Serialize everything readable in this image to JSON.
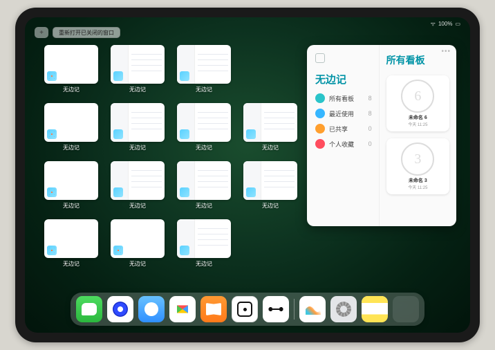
{
  "status": {
    "battery": "100%",
    "wifi": "􀙇"
  },
  "topbar": {
    "new_tab": "+",
    "reopen_label": "重新打开已关闭的窗口"
  },
  "grid": {
    "app_label": "无边记",
    "tiles": [
      {
        "variant": "blank"
      },
      {
        "variant": "list"
      },
      {
        "variant": "list"
      },
      {
        "variant": "blank"
      },
      {
        "variant": "list"
      },
      {
        "variant": "list"
      },
      {
        "variant": "list"
      },
      {
        "variant": "blank"
      },
      {
        "variant": "list"
      },
      {
        "variant": "list"
      },
      {
        "variant": "list"
      },
      {
        "variant": "blank"
      },
      {
        "variant": "blank"
      },
      {
        "variant": "list"
      }
    ]
  },
  "panel": {
    "left_title": "无边记",
    "right_title": "所有看板",
    "items": [
      {
        "icon_color": "#2ac4c9",
        "label": "所有看板",
        "count": "8"
      },
      {
        "icon_color": "#36b6ff",
        "label": "最近使用",
        "count": "8"
      },
      {
        "icon_color": "#ff9f2e",
        "label": "已共享",
        "count": "0"
      },
      {
        "icon_color": "#ff4d5e",
        "label": "个人收藏",
        "count": "0"
      }
    ],
    "cards": [
      {
        "name": "未命名 6",
        "time": "今天 11:25",
        "sketch": "six"
      },
      {
        "name": "未命名 3",
        "time": "今天 11:25",
        "sketch": "three"
      }
    ]
  },
  "dock": [
    {
      "name": "wechat"
    },
    {
      "name": "browser1"
    },
    {
      "name": "browser2"
    },
    {
      "name": "play"
    },
    {
      "name": "books"
    },
    {
      "name": "dice"
    },
    {
      "name": "connect"
    },
    {
      "sep": true
    },
    {
      "name": "freeform"
    },
    {
      "name": "settings"
    },
    {
      "name": "notes"
    },
    {
      "name": "apps"
    }
  ]
}
